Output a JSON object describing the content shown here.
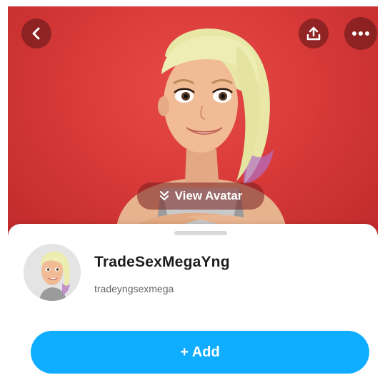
{
  "header": {
    "back_icon": "chevron-left-icon",
    "share_icon": "upload-share-icon",
    "more_icon": "more-horizontal-icon"
  },
  "hero": {
    "background_color": "#d93a3a",
    "view_avatar_label": "View Avatar",
    "view_avatar_icon": "double-chevron-down-icon"
  },
  "profile": {
    "display_name": "TradeSexMegaYng",
    "username": "tradeyngsexmega"
  },
  "actions": {
    "add_label": "+ Add",
    "add_color": "#0fadff"
  }
}
